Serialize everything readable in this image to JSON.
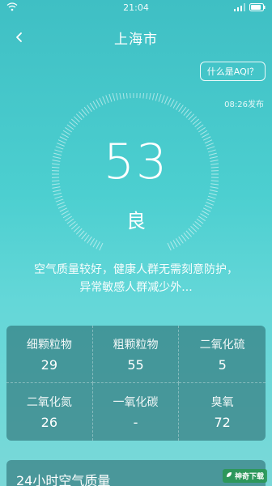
{
  "status_bar": {
    "time": "21:04",
    "icons": [
      "wifi-icon",
      "signal-icon",
      "battery-icon"
    ]
  },
  "header": {
    "title": "上海市",
    "back_icon": "chevron-left-icon"
  },
  "aqi_button_label": "什么是AQI？",
  "publish_time": "08:26发布",
  "aqi": {
    "value": "53",
    "level": "良"
  },
  "advice": "空气质量较好，健康人群无需刻意防护，异常敏感人群减少外...",
  "pollutants": [
    {
      "label": "细颗粒物",
      "value": "29"
    },
    {
      "label": "粗颗粒物",
      "value": "55"
    },
    {
      "label": "二氧化硫",
      "value": "5"
    },
    {
      "label": "二氧化氮",
      "value": "26"
    },
    {
      "label": "一氧化碳",
      "value": "-"
    },
    {
      "label": "臭氧",
      "value": "72"
    }
  ],
  "section_24h_title": "24小时空气质量",
  "watermark": "神奇下载",
  "colors": {
    "bg_top": "#3fbfc4",
    "bg_bottom": "#7ad8d8",
    "panel": "#246268"
  }
}
